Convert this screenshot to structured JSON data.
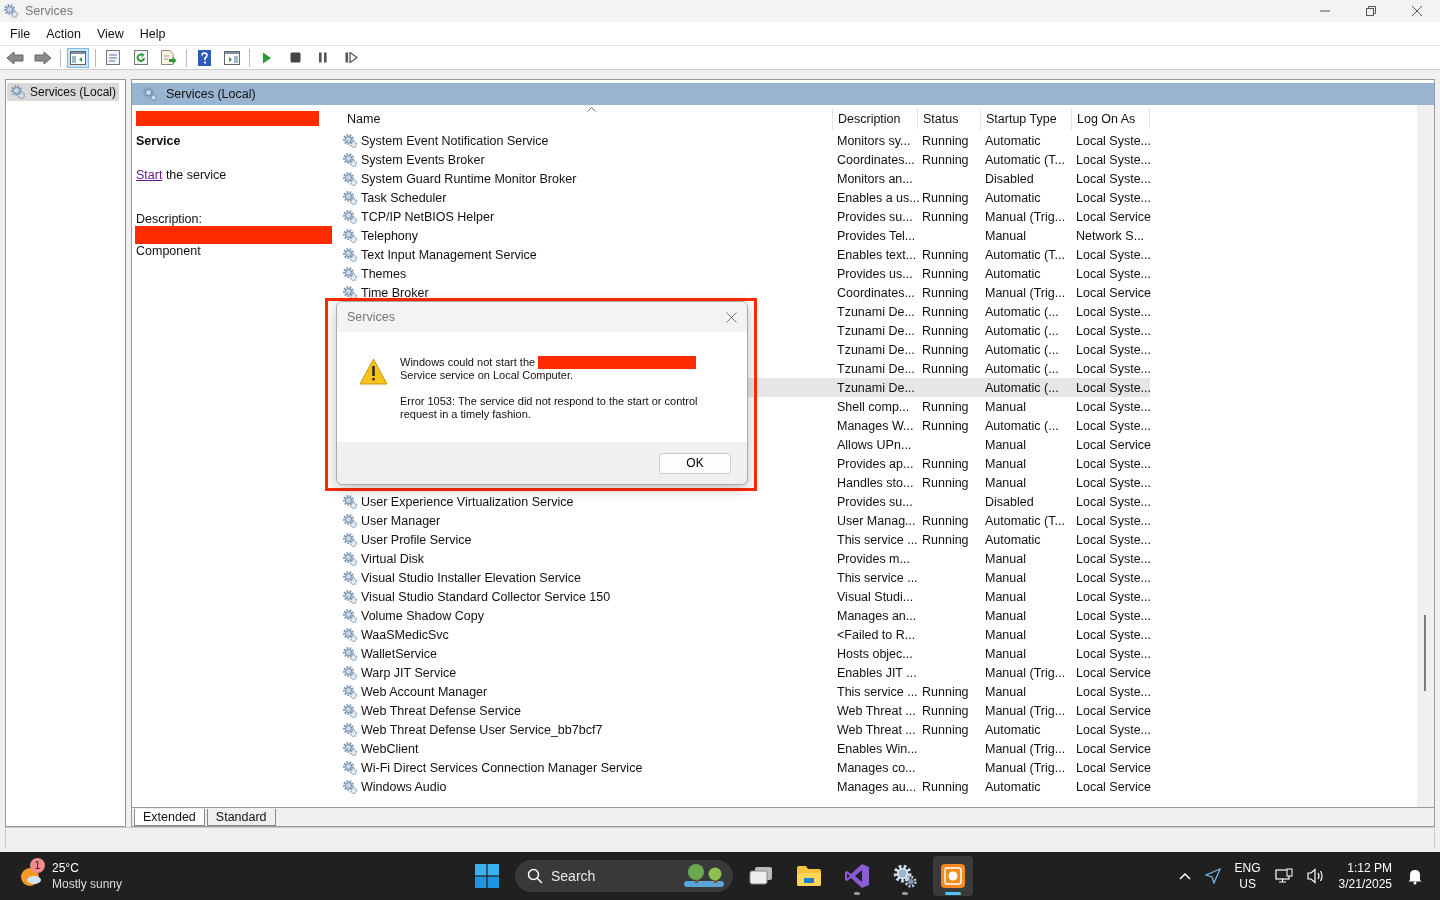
{
  "window": {
    "title": "Services",
    "controls": [
      {
        "kind": "minimize"
      },
      {
        "kind": "restore"
      },
      {
        "kind": "close"
      }
    ]
  },
  "menu": [
    "File",
    "Action",
    "View",
    "Help"
  ],
  "toolbar": [
    {
      "kind": "back",
      "pressed": false
    },
    {
      "kind": "forward",
      "pressed": false,
      "group_end": true
    },
    {
      "kind": "tree",
      "pressed": true,
      "group_end": true
    },
    {
      "kind": "properties",
      "pressed": false
    },
    {
      "kind": "refresh",
      "pressed": false
    },
    {
      "kind": "export",
      "pressed": false,
      "group_end": true
    },
    {
      "kind": "help",
      "pressed": false
    },
    {
      "kind": "pane",
      "pressed": false,
      "group_end": true
    },
    {
      "kind": "play",
      "pressed": false
    },
    {
      "kind": "stop",
      "pressed": false
    },
    {
      "kind": "pause",
      "pressed": false
    },
    {
      "kind": "resume",
      "pressed": false
    }
  ],
  "tree": {
    "items": [
      {
        "label": "Services (Local)",
        "selected": true
      }
    ]
  },
  "pane": {
    "title": "Services (Local)"
  },
  "details": {
    "heading": "Service",
    "link": "Start",
    "link_rest": "the service",
    "description_label": "Description:",
    "description_text": "Component"
  },
  "table": {
    "columns": [
      {
        "label": "Name",
        "sorted": true
      },
      {
        "label": "Description",
        "sorted": false
      },
      {
        "label": "Status",
        "sorted": false
      },
      {
        "label": "Startup Type",
        "sorted": false
      },
      {
        "label": "Log On As",
        "sorted": false
      }
    ],
    "rows": [
      {
        "name": "System Event Notification Service",
        "description": "Monitors sy...",
        "status": "Running",
        "startup": "Automatic",
        "logon": "Local Syste...",
        "selected": false
      },
      {
        "name": "System Events Broker",
        "description": "Coordinates...",
        "status": "Running",
        "startup": "Automatic (T...",
        "logon": "Local Syste...",
        "selected": false
      },
      {
        "name": "System Guard Runtime Monitor Broker",
        "description": "Monitors an...",
        "startup": "Disabled",
        "logon": "Local Syste...",
        "selected": false
      },
      {
        "name": "Task Scheduler",
        "description": "Enables a us...",
        "status": "Running",
        "startup": "Automatic",
        "logon": "Local Syste...",
        "selected": false
      },
      {
        "name": "TCP/IP NetBIOS Helper",
        "description": "Provides su...",
        "status": "Running",
        "startup": "Manual (Trig...",
        "logon": "Local Service",
        "selected": false
      },
      {
        "name": "Telephony",
        "description": "Provides Tel...",
        "startup": "Manual",
        "logon": "Network S...",
        "selected": false
      },
      {
        "name": "Text Input Management Service",
        "description": "Enables text...",
        "status": "Running",
        "startup": "Automatic (T...",
        "logon": "Local Syste...",
        "selected": false
      },
      {
        "name": "Themes",
        "description": "Provides us...",
        "status": "Running",
        "startup": "Automatic",
        "logon": "Local Syste...",
        "selected": false
      },
      {
        "name": "Time Broker",
        "description": "Coordinates...",
        "status": "Running",
        "startup": "Manual (Trig...",
        "logon": "Local Service",
        "selected": false
      },
      {
        "description": "Tzunami De...",
        "status": "Running",
        "startup": "Automatic (...",
        "logon": "Local Syste...",
        "selected": false
      },
      {
        "description": "Tzunami De...",
        "status": "Running",
        "startup": "Automatic (...",
        "logon": "Local Syste...",
        "selected": false
      },
      {
        "description": "Tzunami De...",
        "status": "Running",
        "startup": "Automatic (...",
        "logon": "Local Syste...",
        "selected": false
      },
      {
        "description": "Tzunami De...",
        "status": "Running",
        "startup": "Automatic (...",
        "logon": "Local Syste...",
        "selected": false
      },
      {
        "description": "Tzunami De...",
        "startup": "Automatic (...",
        "logon": "Local Syste...",
        "selected": true
      },
      {
        "description": "Shell comp...",
        "status": "Running",
        "startup": "Manual",
        "logon": "Local Syste...",
        "selected": false
      },
      {
        "description": "Manages W...",
        "status": "Running",
        "startup": "Automatic (...",
        "logon": "Local Syste...",
        "selected": false
      },
      {
        "description": "Allows UPn...",
        "startup": "Manual",
        "logon": "Local Service",
        "selected": false
      },
      {
        "description": "Provides ap...",
        "status": "Running",
        "startup": "Manual",
        "logon": "Local Syste...",
        "selected": false
      },
      {
        "description": "Handles sto...",
        "status": "Running",
        "startup": "Manual",
        "logon": "Local Syste...",
        "selected": false
      },
      {
        "name": "User Experience Virtualization Service",
        "description": "Provides su...",
        "startup": "Disabled",
        "logon": "Local Syste...",
        "selected": false
      },
      {
        "name": "User Manager",
        "description": "User Manag...",
        "status": "Running",
        "startup": "Automatic (T...",
        "logon": "Local Syste...",
        "selected": false
      },
      {
        "name": "User Profile Service",
        "description": "This service ...",
        "status": "Running",
        "startup": "Automatic",
        "logon": "Local Syste...",
        "selected": false
      },
      {
        "name": "Virtual Disk",
        "description": "Provides m...",
        "startup": "Manual",
        "logon": "Local Syste...",
        "selected": false
      },
      {
        "name": "Visual Studio Installer Elevation Service",
        "description": "This service ...",
        "startup": "Manual",
        "logon": "Local Syste...",
        "selected": false
      },
      {
        "name": "Visual Studio Standard Collector Service 150",
        "description": "Visual Studi...",
        "startup": "Manual",
        "logon": "Local Syste...",
        "selected": false
      },
      {
        "name": "Volume Shadow Copy",
        "description": "Manages an...",
        "startup": "Manual",
        "logon": "Local Syste...",
        "selected": false
      },
      {
        "name": "WaaSMedicSvc",
        "description": "<Failed to R...",
        "startup": "Manual",
        "logon": "Local Syste...",
        "selected": false
      },
      {
        "name": "WalletService",
        "description": "Hosts objec...",
        "startup": "Manual",
        "logon": "Local Syste...",
        "selected": false
      },
      {
        "name": "Warp JIT Service",
        "description": "Enables JIT ...",
        "startup": "Manual (Trig...",
        "logon": "Local Service",
        "selected": false
      },
      {
        "name": "Web Account Manager",
        "description": "This service ...",
        "status": "Running",
        "startup": "Manual",
        "logon": "Local Syste...",
        "selected": false
      },
      {
        "name": "Web Threat Defense Service",
        "description": "Web Threat ...",
        "status": "Running",
        "startup": "Manual (Trig...",
        "logon": "Local Service",
        "selected": false
      },
      {
        "name": "Web Threat Defense User Service_bb7bcf7",
        "description": "Web Threat ...",
        "status": "Running",
        "startup": "Automatic",
        "logon": "Local Syste...",
        "selected": false
      },
      {
        "name": "WebClient",
        "description": "Enables Win...",
        "startup": "Manual (Trig...",
        "logon": "Local Service",
        "selected": false
      },
      {
        "name": "Wi-Fi Direct Services Connection Manager Service",
        "description": "Manages co...",
        "startup": "Manual (Trig...",
        "logon": "Local Service",
        "selected": false
      },
      {
        "name": "Windows Audio",
        "description": "Manages au...",
        "status": "Running",
        "startup": "Automatic",
        "logon": "Local Service",
        "selected": false
      }
    ]
  },
  "view_tabs": [
    {
      "label": "Extended",
      "selected": true
    },
    {
      "label": "Standard",
      "selected": false
    }
  ],
  "dialog": {
    "title": "Services",
    "message_lines": [
      "Windows could not start the",
      "Service service on Local Computer."
    ],
    "error": "Error 1053: The service did not respond to the start or control request in a timely fashion.",
    "button": "OK"
  },
  "taskbar": {
    "weather": {
      "badge": "1",
      "temperature": "25°C",
      "condition": "Mostly sunny"
    },
    "search": {
      "placeholder": "Search"
    },
    "apps": [
      {
        "kind": "start",
        "running": false,
        "selected": false
      },
      {
        "kind": "taskview",
        "running": false,
        "selected": false
      },
      {
        "kind": "explorer",
        "running": false,
        "selected": false
      },
      {
        "kind": "vs",
        "running": true,
        "selected": false
      },
      {
        "kind": "services",
        "running": true,
        "selected": false
      },
      {
        "kind": "recorder",
        "running": true,
        "selected": true
      }
    ],
    "language": [
      "ENG",
      "US"
    ],
    "time": "1:12 PM",
    "date": "3/21/2025"
  }
}
